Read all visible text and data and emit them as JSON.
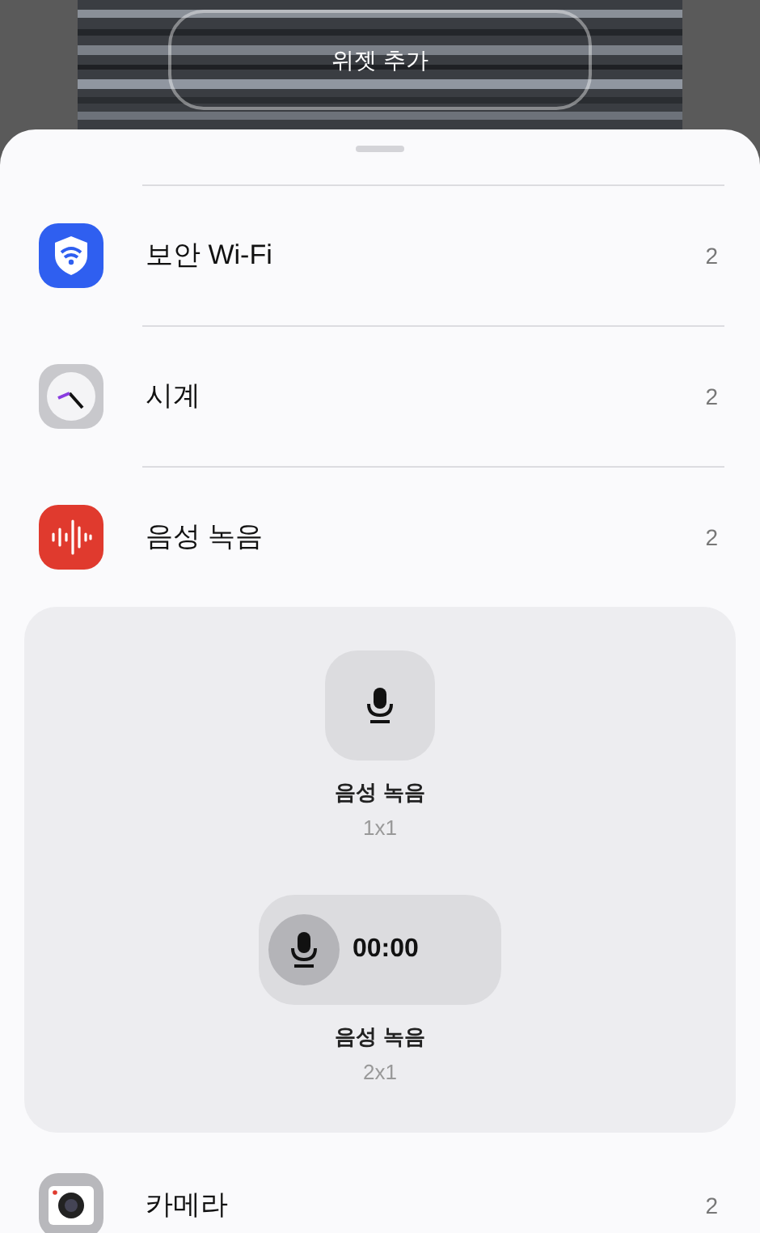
{
  "header": {
    "add_widget_button": "위젯 추가"
  },
  "apps": [
    {
      "kind": "wifi",
      "name": "보안 Wi-Fi",
      "count": "2"
    },
    {
      "kind": "clock",
      "name": "시계",
      "count": "2"
    },
    {
      "kind": "recorder",
      "name": "음성 녹음",
      "count": "2",
      "widgets": [
        {
          "kind": "square",
          "name": "음성 녹음",
          "size": "1x1"
        },
        {
          "kind": "wide",
          "name": "음성 녹음",
          "size": "2x1",
          "time": "00:00"
        }
      ]
    },
    {
      "kind": "camera",
      "name": "카메라",
      "count": "2"
    }
  ]
}
